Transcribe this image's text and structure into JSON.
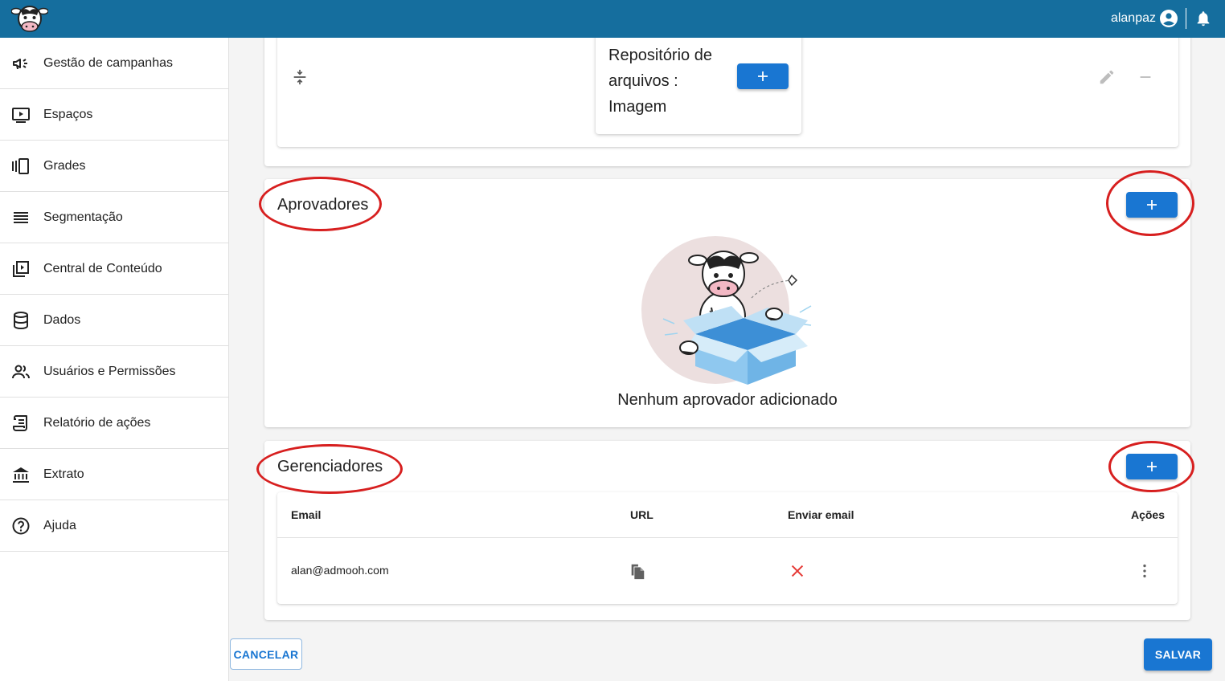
{
  "header": {
    "username": "alanpaz",
    "logo_icon": "cow-logo-icon",
    "user_icon": "account-circle-icon",
    "bell_icon": "bell-icon",
    "color": "#156e9e"
  },
  "sidebar": {
    "items": [
      {
        "label": "Gestão de campanhas",
        "icon": "megaphone-icon"
      },
      {
        "label": "Espaços",
        "icon": "screen-play-icon"
      },
      {
        "label": "Grades",
        "icon": "carousel-icon"
      },
      {
        "label": "Segmentação",
        "icon": "lines-icon"
      },
      {
        "label": "Central de Conteúdo",
        "icon": "video-library-icon"
      },
      {
        "label": "Dados",
        "icon": "database-icon"
      },
      {
        "label": "Usuários e Permissões",
        "icon": "people-icon"
      },
      {
        "label": "Relatório de ações",
        "icon": "scroll-icon"
      },
      {
        "label": "Extrato",
        "icon": "bank-icon"
      },
      {
        "label": "Ajuda",
        "icon": "help-circle-icon"
      }
    ]
  },
  "repository": {
    "title": "Repositório de arquivos : Imagem"
  },
  "approvers": {
    "title": "Aprovadores",
    "empty_text": "Nenhum aprovador adicionado"
  },
  "managers": {
    "title": "Gerenciadores",
    "columns": [
      "Email",
      "URL",
      "Enviar email",
      "Ações"
    ],
    "rows": [
      {
        "email": "alan@admooh.com",
        "url_icon": "copy-icon",
        "send_email_icon": "x-icon",
        "actions_icon": "more-vert-icon"
      }
    ]
  },
  "footer": {
    "cancel_label": "CANCELAR",
    "save_label": "SALVAR"
  },
  "colors": {
    "primary": "#1976d2",
    "highlight": "#d71f1f",
    "danger": "#e53935"
  }
}
